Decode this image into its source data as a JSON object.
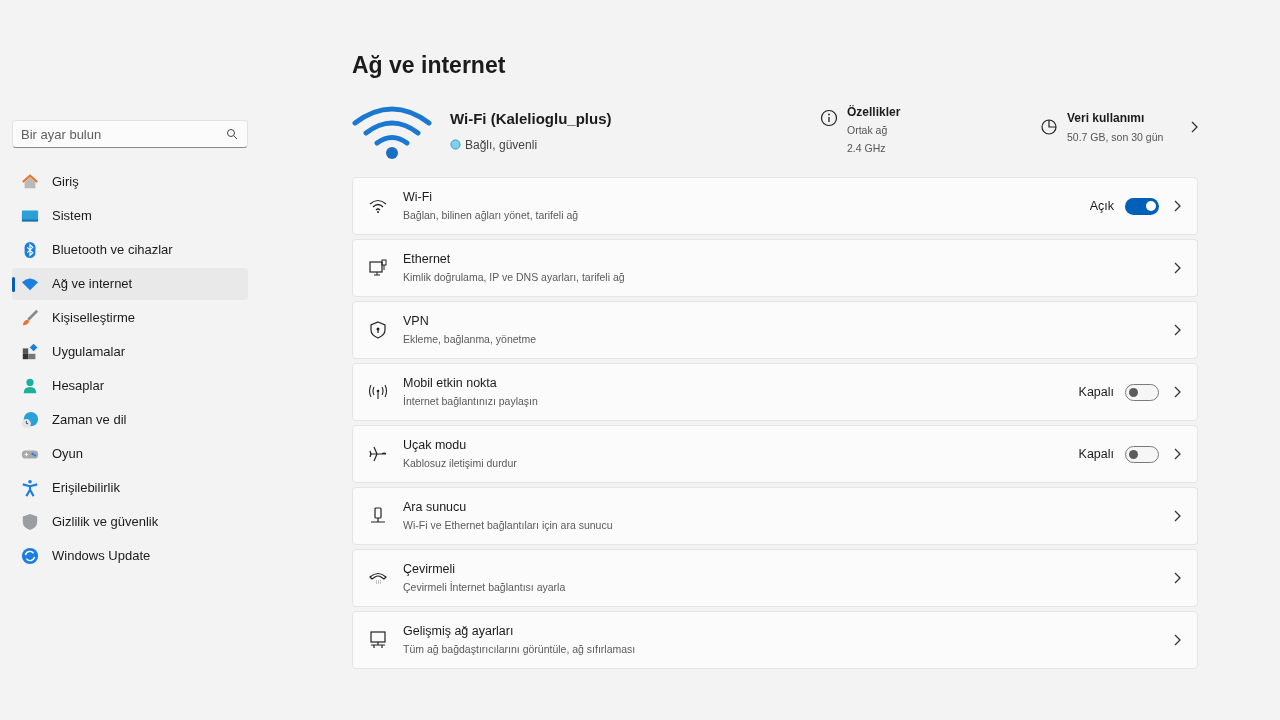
{
  "search": {
    "placeholder": "Bir ayar bulun"
  },
  "nav": [
    {
      "label": "Giriş",
      "selected": false
    },
    {
      "label": "Sistem",
      "selected": false
    },
    {
      "label": "Bluetooth ve cihazlar",
      "selected": false
    },
    {
      "label": "Ağ ve internet",
      "selected": true
    },
    {
      "label": "Kişiselleştirme",
      "selected": false
    },
    {
      "label": "Uygulamalar",
      "selected": false
    },
    {
      "label": "Hesaplar",
      "selected": false
    },
    {
      "label": "Zaman ve dil",
      "selected": false
    },
    {
      "label": "Oyun",
      "selected": false
    },
    {
      "label": "Erişilebilirlik",
      "selected": false
    },
    {
      "label": "Gizlilik ve güvenlik",
      "selected": false
    },
    {
      "label": "Windows Update",
      "selected": false
    }
  ],
  "page_title": "Ağ ve internet",
  "connection": {
    "name": "Wi-Fi (Kalelioglu_plus)",
    "status": "Bağlı, güvenli"
  },
  "properties": {
    "title": "Özellikler",
    "lines": [
      "Ortak ağ",
      "2.4 GHz"
    ]
  },
  "data_usage": {
    "title": "Veri kullanımı",
    "detail": "50.7 GB, son 30 gün"
  },
  "settings": [
    {
      "kind": "toggle",
      "title": "Wi-Fi",
      "subtitle": "Bağlan, bilinen ağları yönet, tarifeli ağ",
      "state_label": "Açık",
      "on": true
    },
    {
      "kind": "link",
      "title": "Ethernet",
      "subtitle": "Kimlik doğrulama, IP ve DNS ayarları, tarifeli ağ"
    },
    {
      "kind": "link",
      "title": "VPN",
      "subtitle": "Ekleme, bağlanma, yönetme"
    },
    {
      "kind": "toggle",
      "title": "Mobil etkin nokta",
      "subtitle": "İnternet bağlantınızı paylaşın",
      "state_label": "Kapalı",
      "on": false
    },
    {
      "kind": "toggle",
      "title": "Uçak modu",
      "subtitle": "Kablosuz iletişimi durdur",
      "state_label": "Kapalı",
      "on": false
    },
    {
      "kind": "link",
      "title": "Ara sunucu",
      "subtitle": "Wi-Fi ve Ethernet bağlantıları için ara sunucu"
    },
    {
      "kind": "link",
      "title": "Çevirmeli",
      "subtitle": "Çevirmeli İnternet bağlantısı ayarla"
    },
    {
      "kind": "link",
      "title": "Gelişmiş ağ ayarları",
      "subtitle": "Tüm ağ bağdaştırıcılarını görüntüle, ağ sıfırlaması"
    }
  ]
}
